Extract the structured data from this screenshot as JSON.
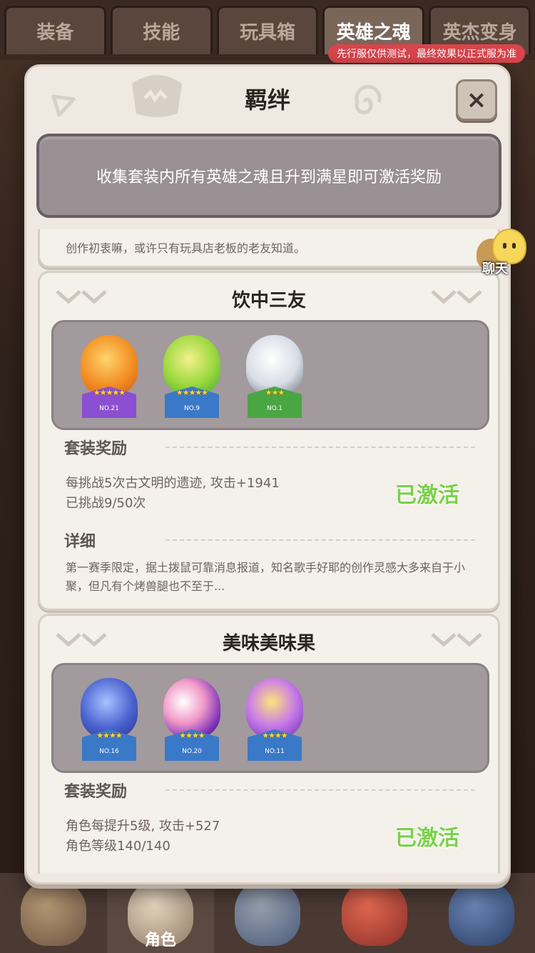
{
  "top_tabs": [
    "装备",
    "技能",
    "玩具箱",
    "英雄之魂",
    "英杰变身"
  ],
  "active_tab_index": 3,
  "test_note": "先行服仅供测试，最终效果以正式服为准",
  "modal": {
    "title": "羁绊",
    "close_icon": "×",
    "notice": "收集套装内所有英雄之魂且升到满星即可激活奖励"
  },
  "prev_card": {
    "text": "创作初衷嘛，或许只有玩具店老板的老友知道。"
  },
  "sets": [
    {
      "name": "饮中三友",
      "heroes": [
        {
          "no": "NO.21",
          "stars": "★★★★★",
          "color": "#f39a2b",
          "plate": "#8b4fd1"
        },
        {
          "no": "NO.9",
          "stars": "★★★★★",
          "color": "#8ad63a",
          "plate": "#3a79c8"
        },
        {
          "no": "NO.1",
          "stars": "★★★",
          "color": "#e9eef3",
          "plate": "#49a642"
        }
      ],
      "reward_head": "套装奖励",
      "reward_lines": [
        "每挑战5次古文明的遗迹, 攻击+1941",
        "已挑战9/50次"
      ],
      "status": "已激活",
      "detail_head": "详细",
      "detail_text": "第一赛季限定，据土拨鼠可靠消息报道，知名歌手好耶的创作灵感大多来自于小聚，但凡有个烤兽腿也不至于..."
    },
    {
      "name": "美味美味果",
      "heroes": [
        {
          "no": "NO.16",
          "stars": "★★★★",
          "color": "#5b77d9",
          "plate": "#3a79c8"
        },
        {
          "no": "NO.20",
          "stars": "★★★★",
          "color": "#c04ad1",
          "plate": "#3a79c8"
        },
        {
          "no": "NO.11",
          "stars": "★★★★",
          "color": "#b565e0",
          "plate": "#3a79c8"
        }
      ],
      "reward_head": "套装奖励",
      "reward_lines": [
        "角色每提升5级, 攻击+527",
        "角色等级140/140"
      ],
      "status": "已激活"
    }
  ],
  "chat": {
    "label": "聊天"
  },
  "bottom_nav": {
    "active_label": "角色"
  }
}
